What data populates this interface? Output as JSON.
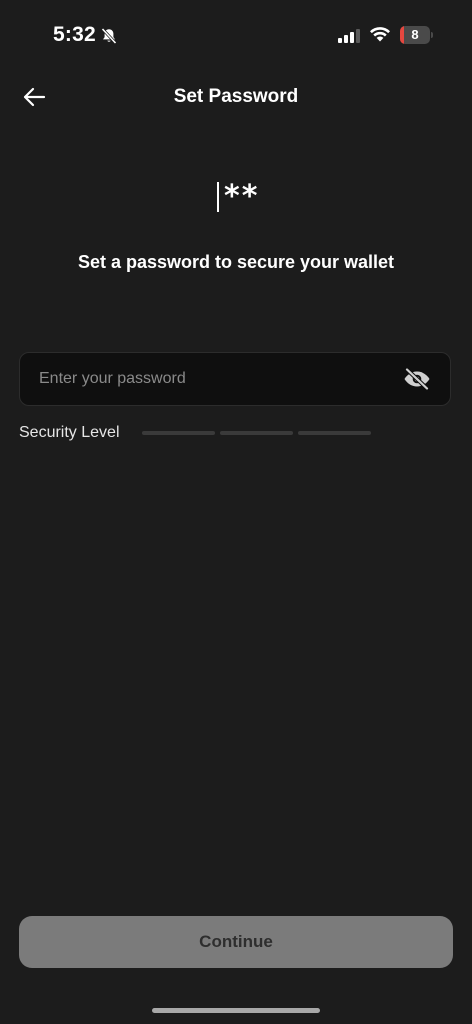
{
  "status_bar": {
    "time": "5:32",
    "battery_level": "8",
    "battery_fraction": 0.08,
    "icons": [
      "bell-off-icon",
      "cellular-signal-icon",
      "wifi-icon",
      "battery-icon"
    ]
  },
  "header": {
    "title": "Set Password",
    "back_icon": "arrow-left-icon"
  },
  "illustration": {
    "stars": "**"
  },
  "subtitle": "Set a password to secure your wallet",
  "password_field": {
    "placeholder": "Enter your password",
    "value": "",
    "toggle_icon": "eye-off-icon"
  },
  "security": {
    "label": "Security Level",
    "segments": 3,
    "filled": 0
  },
  "continue_button": {
    "label": "Continue"
  },
  "colors": {
    "background": "#1c1c1c",
    "field_background": "#0f0f0f",
    "button_disabled": "#7b7b7b",
    "battery_low": "#e5473f"
  }
}
